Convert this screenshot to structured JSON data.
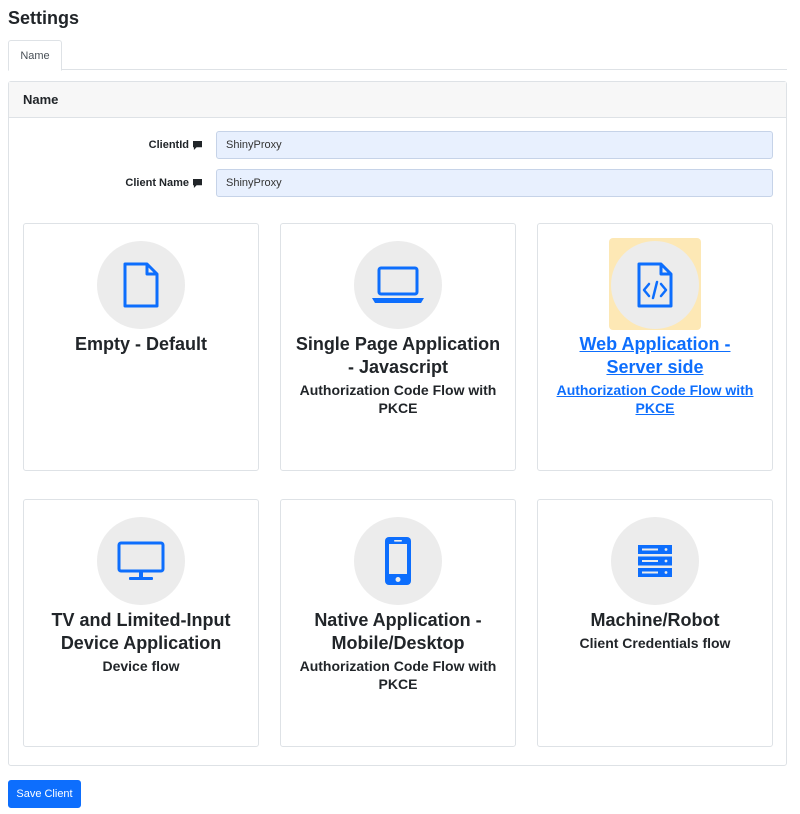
{
  "page": {
    "title": "Settings"
  },
  "tabs": [
    {
      "label": "Name"
    }
  ],
  "card": {
    "header": "Name",
    "fields": [
      {
        "label": "ClientId",
        "value": "ShinyProxy"
      },
      {
        "label": "Client Name",
        "value": "ShinyProxy"
      }
    ]
  },
  "client_types": [
    {
      "title": "Empty - Default",
      "subtitle": "",
      "icon": "file-icon"
    },
    {
      "title": "Single Page Application - Javascript",
      "subtitle": "Authorization Code Flow with PKCE",
      "icon": "laptop-icon"
    },
    {
      "title": "Web Application - Server side",
      "subtitle": "Authorization Code Flow with PKCE",
      "icon": "file-code-icon",
      "selected": true
    },
    {
      "title": "TV and Limited-Input Device Application",
      "subtitle": "Device flow",
      "icon": "monitor-icon"
    },
    {
      "title": "Native Application - Mobile/Desktop",
      "subtitle": "Authorization Code Flow with PKCE",
      "icon": "phone-icon"
    },
    {
      "title": "Machine/Robot",
      "subtitle": "Client Credentials flow",
      "icon": "server-icon"
    }
  ],
  "actions": {
    "save_label": "Save Client"
  },
  "colors": {
    "primary": "#0d6efd",
    "icon_bg": "#ececec",
    "highlight": "#fde8b5"
  }
}
